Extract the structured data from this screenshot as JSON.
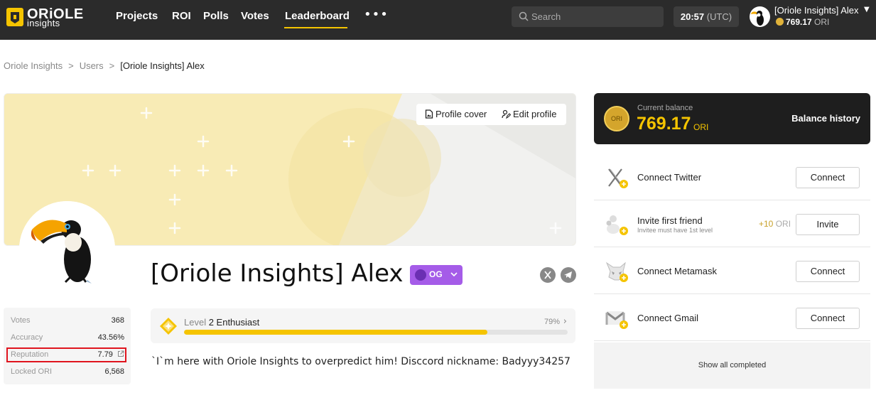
{
  "brand": {
    "title": "ORiOLE",
    "subtitle": "insights"
  },
  "nav": {
    "items": [
      {
        "label": "Projects"
      },
      {
        "label": "ROI"
      },
      {
        "label": "Polls"
      },
      {
        "label": "Votes"
      },
      {
        "label": "Leaderboard",
        "active": true
      }
    ],
    "more_label": "•••"
  },
  "search": {
    "placeholder": "Search",
    "value": ""
  },
  "clock": {
    "time": "20:57",
    "timezone": "(UTC)"
  },
  "user": {
    "name": "[Oriole Insights] Alex",
    "balance": "769.17",
    "currency": "ORI"
  },
  "breadcrumb": {
    "items": [
      "Oriole Insights",
      "Users"
    ],
    "current": "[Oriole Insights] Alex",
    "separator": ">"
  },
  "cover": {
    "cover_button": "Profile cover",
    "edit_button": "Edit profile"
  },
  "profile": {
    "name": "[Oriole Insights] Alex",
    "badge": "OG",
    "bio": "`I`m here with Oriole Insights to overpredict him! Disccord nickname: Badyyy34257"
  },
  "stats": [
    {
      "label": "Votes",
      "value": "368"
    },
    {
      "label": "Accuracy",
      "value": "43.56%"
    },
    {
      "label": "Reputation",
      "value": "7.79"
    },
    {
      "label": "Locked ORI",
      "value": "6,568"
    }
  ],
  "level": {
    "prefix": "Level",
    "name": "2 Enthusiast",
    "percent_label": "79%",
    "progress": 0.79
  },
  "balance": {
    "label": "Current balance",
    "value": "769.17",
    "currency": "ORI",
    "coin_text": "ORI",
    "history_label": "Balance history"
  },
  "tasks": [
    {
      "title": "Connect Twitter",
      "subtitle": "",
      "reward": "",
      "button": "Connect",
      "icon": "x-twitter-icon"
    },
    {
      "title": "Invite first friend",
      "subtitle": "Invitee must have 1st level",
      "reward": "+10",
      "reward_currency": "ORI",
      "button": "Invite",
      "icon": "invite-friend-icon"
    },
    {
      "title": "Connect Metamask",
      "subtitle": "",
      "reward": "",
      "button": "Connect",
      "icon": "metamask-icon"
    },
    {
      "title": "Connect Gmail",
      "subtitle": "",
      "reward": "",
      "button": "Connect",
      "icon": "gmail-icon"
    }
  ],
  "show_all_label": "Show all completed",
  "colors": {
    "accent": "#f5c400",
    "nav_bg": "#2b2b2b",
    "badge": "#a55ce8",
    "highlight": "#e0141e"
  }
}
